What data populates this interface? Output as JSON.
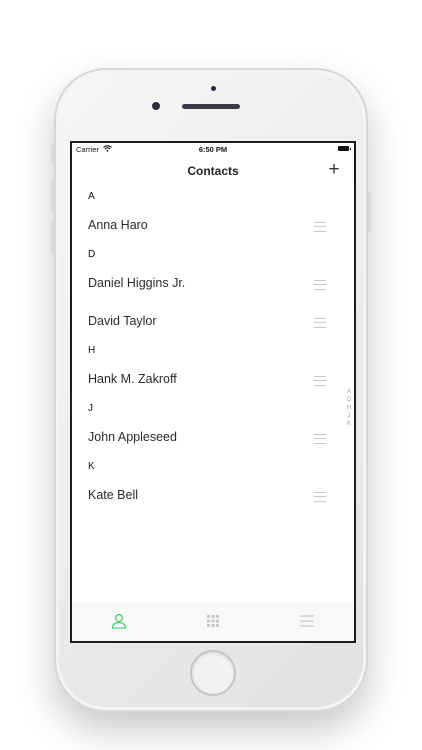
{
  "status_bar": {
    "carrier": "Carrier",
    "time": "6:50 PM"
  },
  "nav": {
    "title": "Contacts",
    "add_label": "+"
  },
  "sections": [
    {
      "letter": "A",
      "contacts": [
        "Anna Haro"
      ]
    },
    {
      "letter": "D",
      "contacts": [
        "Daniel Higgins Jr.",
        "David Taylor"
      ]
    },
    {
      "letter": "H",
      "contacts": [
        "Hank M. Zakroff"
      ]
    },
    {
      "letter": "J",
      "contacts": [
        "John Appleseed"
      ]
    },
    {
      "letter": "K",
      "contacts": [
        "Kate Bell"
      ]
    }
  ],
  "index_letters": [
    "A",
    "D",
    "H",
    "J",
    "K"
  ],
  "tabs": [
    {
      "icon": "person-icon",
      "active": true
    },
    {
      "icon": "keypad-icon",
      "active": false
    },
    {
      "icon": "menu-icon",
      "active": false
    }
  ],
  "colors": {
    "accent": "#34c759",
    "inactive_icon": "#c8c8c8"
  }
}
